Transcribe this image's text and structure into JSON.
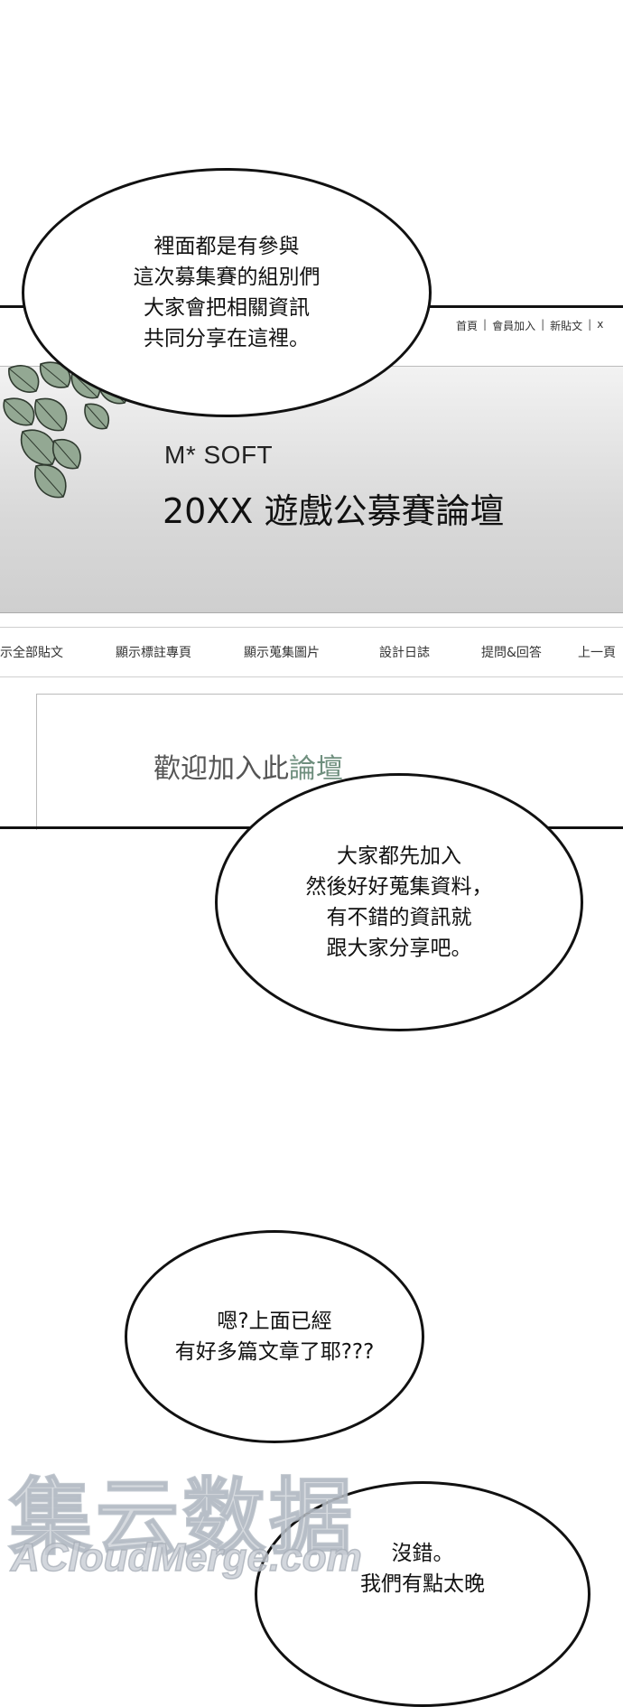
{
  "forum": {
    "topnav": {
      "home": "首頁",
      "join": "會員加入",
      "new_post": "新貼文",
      "extra": "x"
    },
    "brand": "M* SOFT",
    "title": "20XX 遊戲公募賽論壇",
    "menu": [
      "示全部貼文",
      "顯示標註專頁",
      "顯示蒐集圖片",
      "設計日誌",
      "提問&回答",
      "上一頁"
    ],
    "welcome_prefix": "歡迎加入此",
    "welcome_highlight": "論壇"
  },
  "bubbles": [
    {
      "text": "裡面都是有參與\n這次募集賽的組別們\n大家會把相關資訊\n共同分享在這裡。"
    },
    {
      "text": "大家都先加入\n然後好好蒐集資料，\n有不錯的資訊就\n跟大家分享吧。"
    },
    {
      "text": "嗯?上面已經\n有好多篇文章了耶???"
    },
    {
      "text": "沒錯。\n我們有點太晚"
    }
  ],
  "watermark": {
    "cn": "集云数据",
    "en": "ACloudMerge.com"
  },
  "colors": {
    "ink": "#111111",
    "banner_gray": "#d9d9d9",
    "leaf_green": "#93a893",
    "highlight": "#6f8f7e",
    "watermark": "#c8cdd4"
  }
}
